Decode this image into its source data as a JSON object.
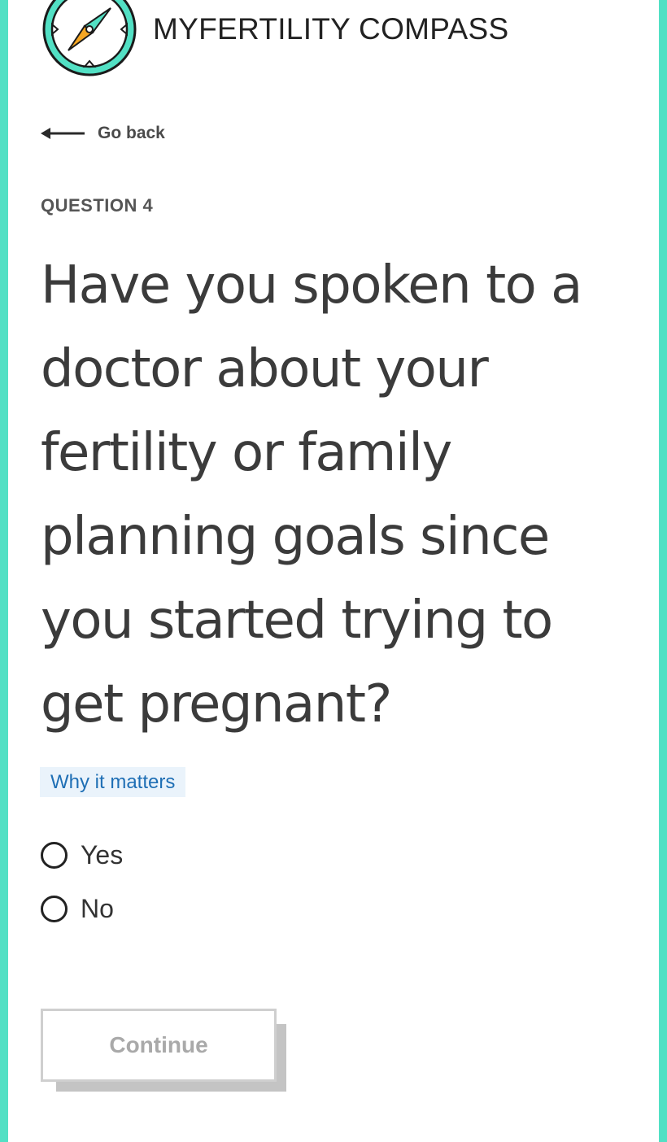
{
  "brand": {
    "name": "MYFERTILITY COMPASS",
    "accent_color": "#52e0c4",
    "logo_icon": "compass-icon"
  },
  "nav": {
    "back_label": "Go back"
  },
  "question": {
    "number_label": "QUESTION 4",
    "text": "Have you spoken to a doctor about your fertility or family planning goals since you started trying to get pregnant?",
    "why_label": "Why it matters"
  },
  "options": [
    {
      "label": "Yes",
      "selected": false
    },
    {
      "label": "No",
      "selected": false
    }
  ],
  "actions": {
    "continue_label": "Continue",
    "continue_enabled": false
  }
}
